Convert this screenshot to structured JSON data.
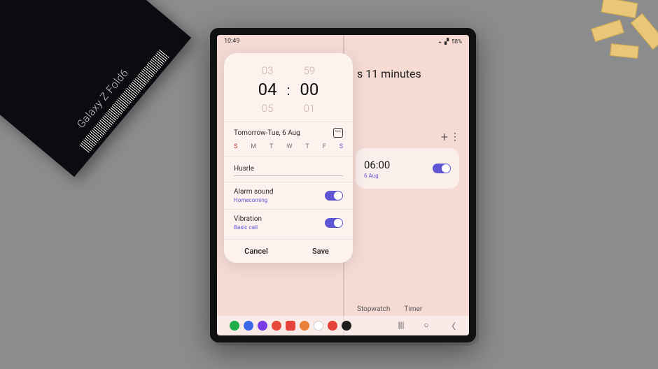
{
  "photo": {
    "box_brand": "Galaxy Z Fold6"
  },
  "status_bar": {
    "time": "10:49",
    "battery_pct": "58%"
  },
  "background_alarm": {
    "countdown_suffix": "s 11 minutes",
    "time": "06:00",
    "subtitle": "6 Aug",
    "toggle_on": true
  },
  "header_actions": {
    "add": "+",
    "more": "⋮"
  },
  "bottom_tabs": {
    "stopwatch": "Stopwatch",
    "timer": "Timer"
  },
  "alarm_editor": {
    "time_prev_h": "03",
    "time_prev_m": "59",
    "time_h": "04",
    "time_m": "00",
    "time_next_h": "05",
    "time_next_m": "01",
    "date_label": "Tomorrow-Tue, 6 Aug",
    "days": [
      "S",
      "M",
      "T",
      "W",
      "T",
      "F",
      "S"
    ],
    "alarm_name": "Husrle",
    "sound_label": "Alarm sound",
    "sound_value": "Homecoming",
    "sound_on": true,
    "vibration_label": "Vibration",
    "vibration_value": "Basic call",
    "vibration_on": true,
    "cancel": "Cancel",
    "save": "Save"
  },
  "dock": {
    "icons": [
      "phone",
      "chat",
      "voice",
      "news",
      "flipboard",
      "camera",
      "play",
      "gallery",
      "watch"
    ],
    "colors": [
      "#1fae4a",
      "#3b68e6",
      "#7a3be6",
      "#e64a3b",
      "#e6443b",
      "#e6803b",
      "#f3ce32",
      "#e6443b",
      "#1e1e1e"
    ]
  }
}
